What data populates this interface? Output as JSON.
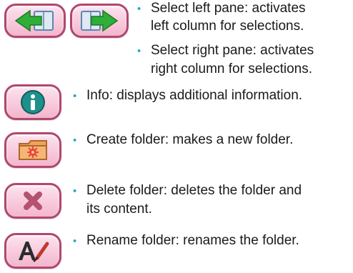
{
  "items": {
    "select_left": {
      "icon": "arrow-left-icon",
      "line1": "Select left pane: activates",
      "line2": "left column for selections."
    },
    "select_right": {
      "icon": "arrow-right-icon",
      "line1": "Select right pane: activates",
      "line2": "right column for selections."
    },
    "info": {
      "icon": "info-icon",
      "line1": "Info: displays additional information."
    },
    "create_folder": {
      "icon": "folder-icon",
      "line1": "Create folder: makes a new folder."
    },
    "delete_folder": {
      "icon": "delete-icon",
      "line1": "Delete folder: deletes the folder and",
      "line2": "its content."
    },
    "rename_folder": {
      "icon": "rename-icon",
      "line1": "Rename folder: renames the folder."
    }
  },
  "bullet_glyph": "•",
  "colors": {
    "button_border": "#b2476e",
    "button_fill": "#f3b5cd",
    "arrow_green": "#2fae3a",
    "info_teal": "#1f8f8c",
    "bullet": "#2fa6c8"
  }
}
